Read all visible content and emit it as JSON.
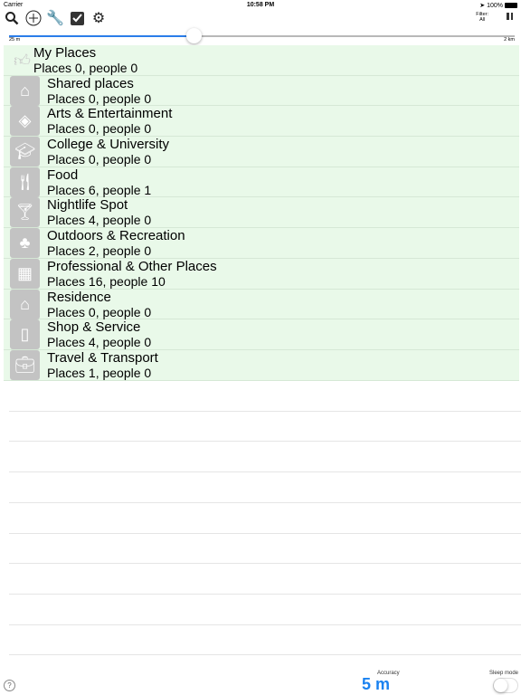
{
  "status": {
    "carrier": "Carrier",
    "time": "10:58 PM",
    "battery": "100%"
  },
  "toolbar": {
    "icons": [
      "search-icon",
      "add-icon",
      "wrench-icon",
      "checklist-icon",
      "gear-icon"
    ],
    "filter_label": "Filter:",
    "filter_value": "All"
  },
  "slider": {
    "min_label": "25 m",
    "max_label": "2 km",
    "value_fraction": 0.365,
    "accent": "#2b7de9"
  },
  "my_places": {
    "title": "My Places",
    "subtitle": "Places 0, people 0"
  },
  "categories": [
    {
      "title": "Shared places",
      "subtitle": "Places 0, people 0",
      "icon": "house-icon"
    },
    {
      "title": "Arts & Entertainment",
      "subtitle": "Places 0, people 0",
      "icon": "ticket-icon"
    },
    {
      "title": "College & University",
      "subtitle": "Places 0, people 0",
      "icon": "graduation-cap-icon"
    },
    {
      "title": "Food",
      "subtitle": "Places 6, people 1",
      "icon": "fork-knife-icon"
    },
    {
      "title": "Nightlife Spot",
      "subtitle": "Places 4, people 0",
      "icon": "cocktail-icon"
    },
    {
      "title": "Outdoors & Recreation",
      "subtitle": "Places 2, people 0",
      "icon": "tree-icon"
    },
    {
      "title": "Professional & Other Places",
      "subtitle": "Places 16, people 10",
      "icon": "building-icon"
    },
    {
      "title": "Residence",
      "subtitle": "Places 0, people 0",
      "icon": "house-icon"
    },
    {
      "title": "Shop & Service",
      "subtitle": "Places 4, people 0",
      "icon": "shopping-bag-icon"
    },
    {
      "title": "Travel & Transport",
      "subtitle": "Places 1, people 0",
      "icon": "suitcase-icon"
    }
  ],
  "footer": {
    "help": "?",
    "accuracy_label": "Accuracy",
    "accuracy_value": "5 m",
    "sleep_label": "Sleep mode",
    "sleep_on": false,
    "accuracy_color": "#1a82f0"
  }
}
